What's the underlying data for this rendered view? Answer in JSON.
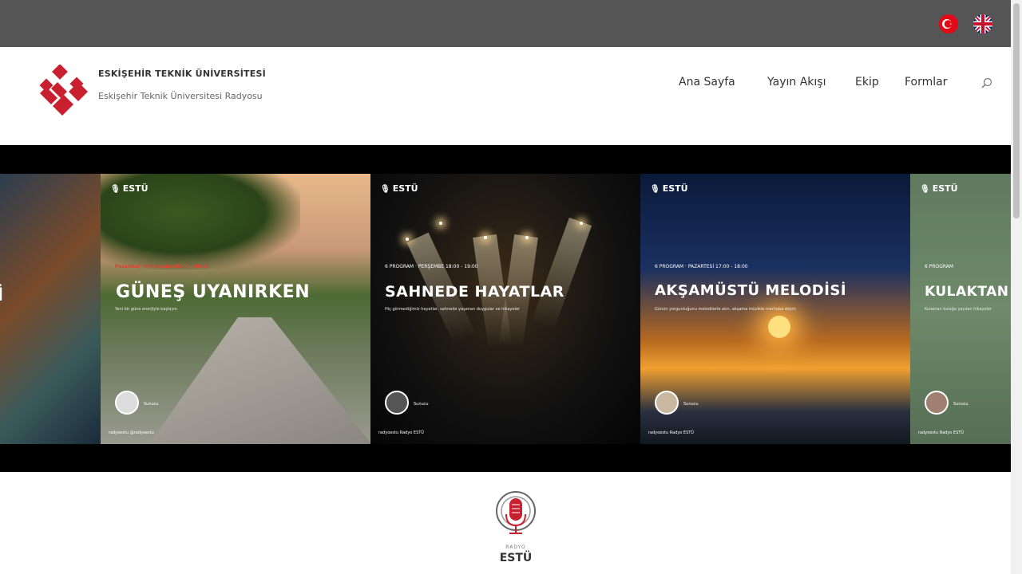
{
  "topbar": {
    "languages": [
      {
        "code": "tr",
        "icon": "turkey-flag-icon"
      },
      {
        "code": "en",
        "icon": "uk-flag-icon"
      }
    ]
  },
  "header": {
    "logo_icon": "estu-logo-icon",
    "title": "ESKİŞEHİR TEKNİK ÜNİVERSİTESİ",
    "subtitle": "Eskişehir Teknik Üniversitesi Radyosu",
    "nav": [
      {
        "label": "Ana Sayfa"
      },
      {
        "label": "Yayın Akışı"
      },
      {
        "label": "Ekip"
      },
      {
        "label": "Formlar"
      }
    ],
    "search_icon": "search-icon"
  },
  "slider": {
    "slides": [
      {
        "brand": "",
        "date": "",
        "title": "İ",
        "desc": "",
        "host": "",
        "footer": ""
      },
      {
        "brand": "ESTÜ",
        "date": "Pazartesi · Perşembe 08:00 - 09:30",
        "title": "GÜNEŞ UYANIRKEN",
        "desc": "Yeni bir güne enerjiyle başlayın",
        "host": "Sunucu",
        "footer": "radyoestu   @radyoestu"
      },
      {
        "brand": "ESTÜ",
        "date": "6 PROGRAM  ·  PERŞEMBE 18:00 - 19:00",
        "title": "SAHNEDE HAYATLAR",
        "desc": "Hiç görmediğimiz hayatlar, sahnede yaşanan duygular ve hikayeler",
        "host": "Sunucu",
        "footer": "radyoestu   Radyo ESTÜ"
      },
      {
        "brand": "ESTÜ",
        "date": "6 PROGRAM  ·  PAZARTESİ 17:00 - 18:00",
        "title": "AKŞAMÜSTÜ MELODİSİ",
        "desc": "Günün yorgunluğunu melodilerle atın, akşama müzikle merhaba deyin",
        "host": "Sunucu",
        "footer": "radyoestu   Radyo ESTÜ"
      },
      {
        "brand": "ESTÜ",
        "date": "6 PROGRAM",
        "title": "KULAKTAN",
        "desc": "Kulaktan kulağa yayılan hikayeler",
        "host": "Sunucu",
        "footer": "radyoestu   Radyo ESTÜ"
      }
    ]
  },
  "radio_logo": {
    "icon": "microphone-icon",
    "small": "RADYO",
    "name": "ESTÜ"
  },
  "colors": {
    "topbar": "#555555",
    "brand_red": "#c8202f",
    "slider_bg": "#000000"
  }
}
